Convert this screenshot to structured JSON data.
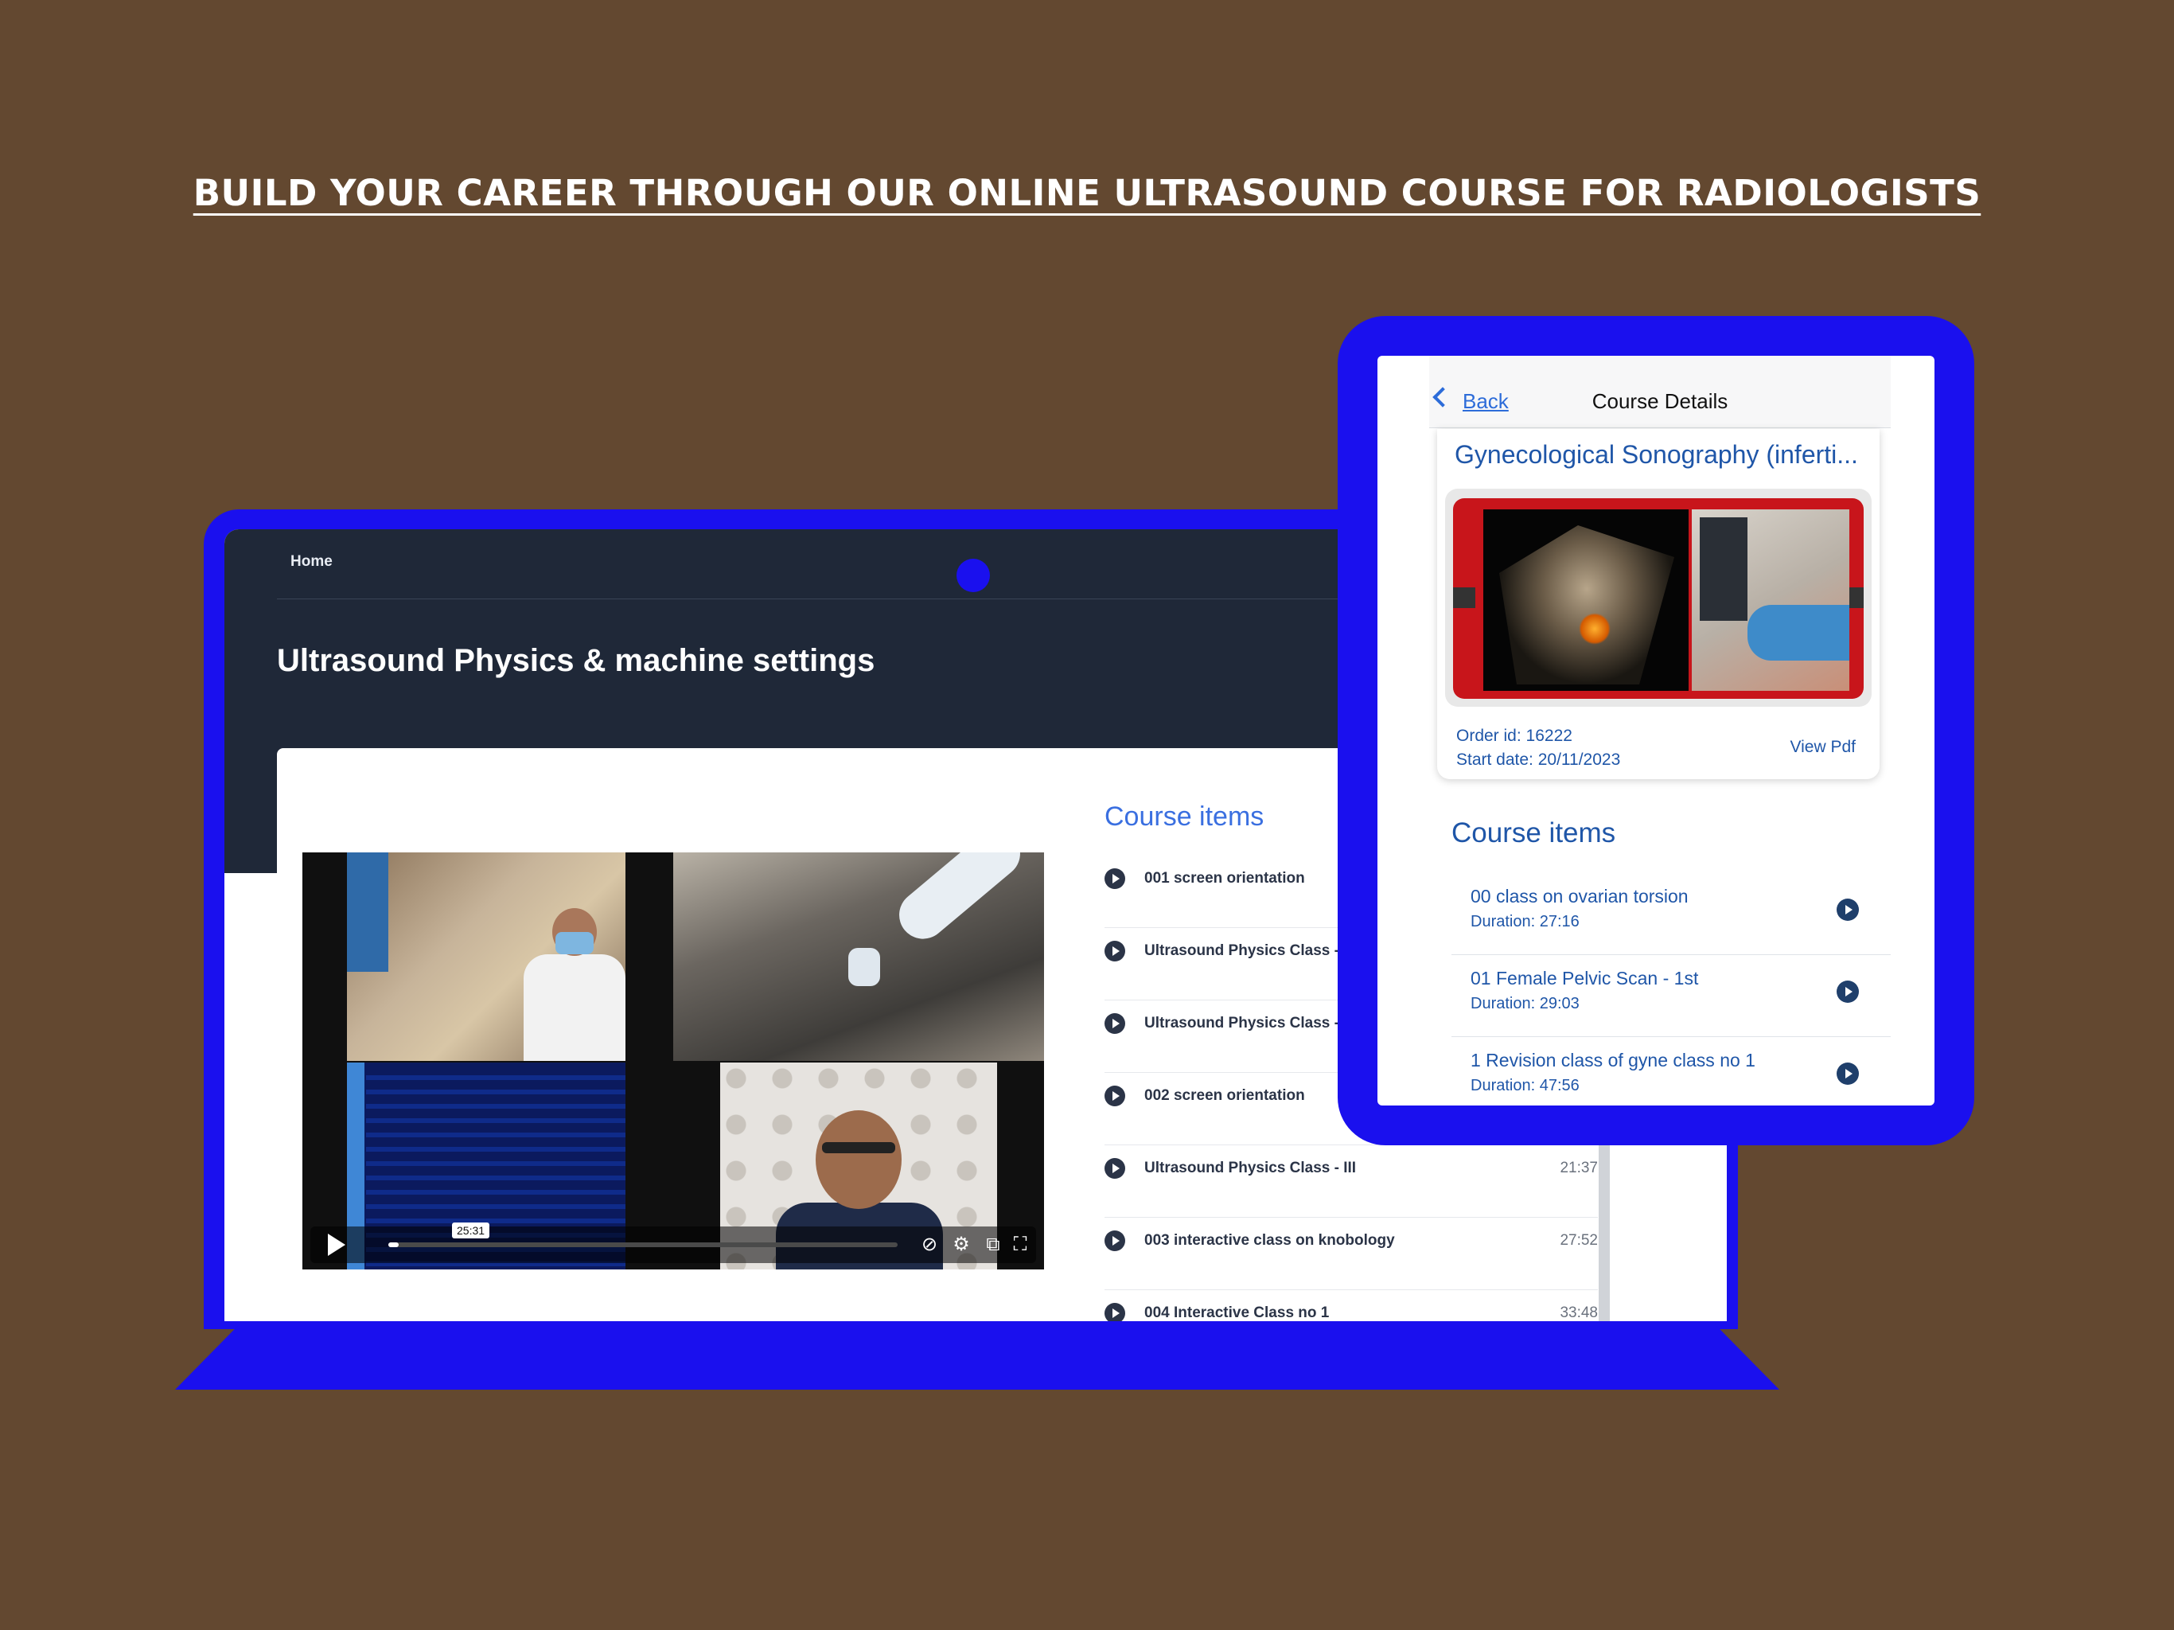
{
  "headline": "BUILD YOUR CAREER THROUGH OUR ONLINE ULTRASOUND COURSE FOR RADIOLOGISTS",
  "colors": {
    "background": "#634830",
    "device_frame": "#1a10ee",
    "laptop_header": "#1f2838",
    "accent_blue": "#3a6fe0",
    "tablet_text": "#1f56a8"
  },
  "laptop": {
    "nav_home": "Home",
    "page_title": "Ultrasound Physics & machine settings",
    "video": {
      "timestamp": "25:31",
      "progress": 0.02,
      "icons": [
        "play-icon",
        "captions-off-icon",
        "settings-icon",
        "picture-in-picture-icon",
        "fullscreen-icon"
      ]
    },
    "course_items_heading": "Course items",
    "course_items": [
      {
        "label": "001 screen orientation",
        "duration": ""
      },
      {
        "label": "Ultrasound Physics Class - I",
        "duration": ""
      },
      {
        "label": "Ultrasound Physics Class - II",
        "duration": ""
      },
      {
        "label": "002 screen orientation",
        "duration": ""
      },
      {
        "label": "Ultrasound Physics Class - III",
        "duration": "21:37"
      },
      {
        "label": "003 interactive class on knobology",
        "duration": "27:52"
      },
      {
        "label": "004 Interactive Class no 1",
        "duration": "33:48"
      }
    ]
  },
  "tablet": {
    "back_label": "Back",
    "nav_title": "Course Details",
    "course_title": "Gynecological Sonography (inferti...",
    "order_id": "Order id: 16222",
    "start_date": "Start date: 20/11/2023",
    "view_pdf": "View Pdf",
    "course_items_heading": "Course items",
    "course_items": [
      {
        "title": "00 class on ovarian torsion",
        "duration": "Duration: 27:16"
      },
      {
        "title": "01 Female Pelvic Scan - 1st",
        "duration": "Duration: 29:03"
      },
      {
        "title": "1 Revision class of gyne class no 1",
        "duration": "Duration: 47:56"
      }
    ]
  }
}
